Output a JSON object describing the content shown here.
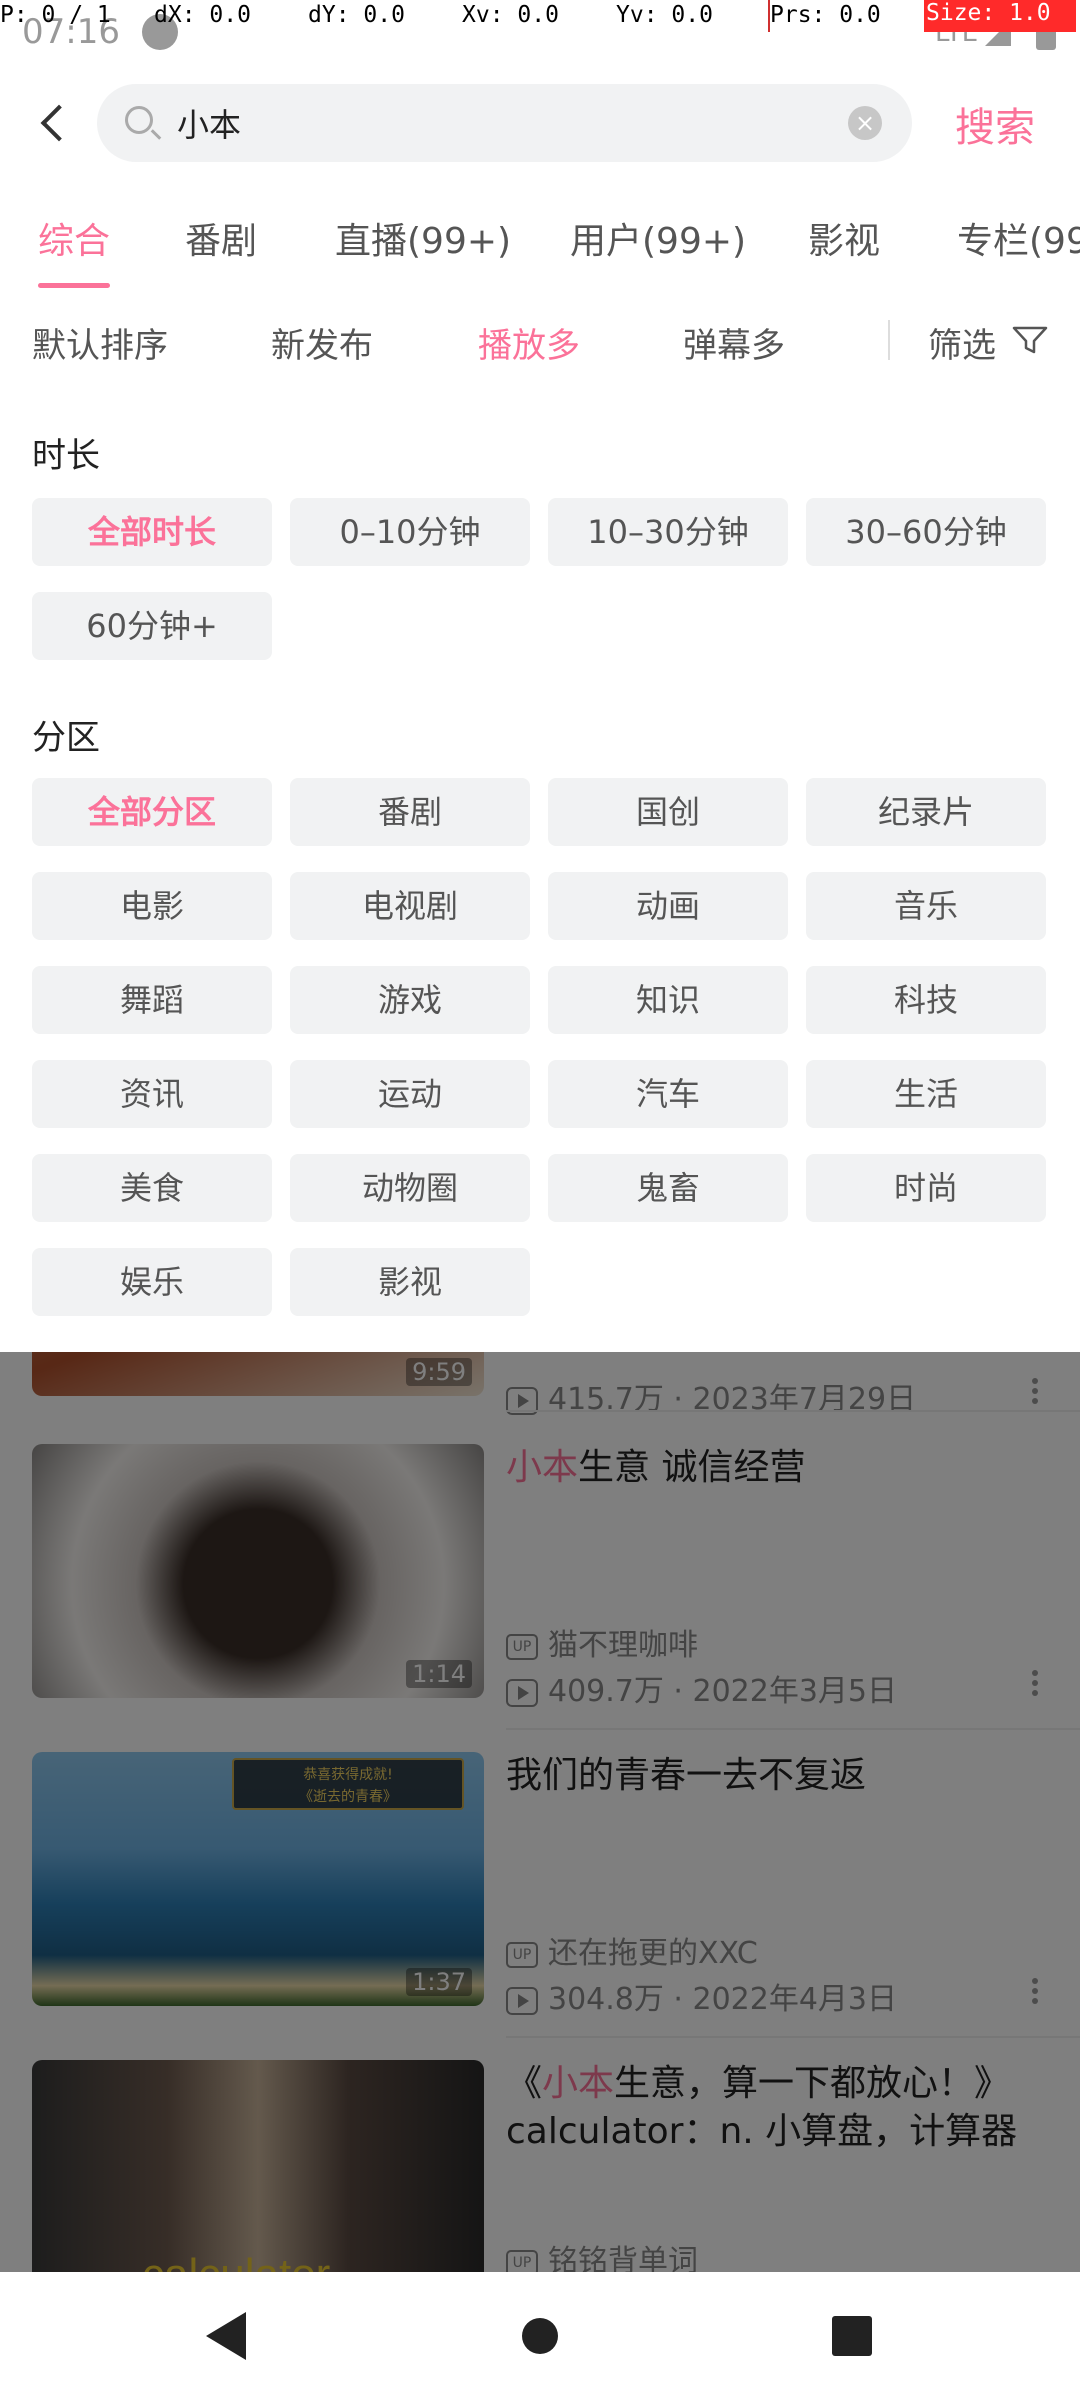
{
  "debug": {
    "pointer": "P: 0 / 1",
    "dx": "dX: 0.0",
    "dy": "dY: 0.0",
    "xv": "Xv: 0.0",
    "yv": "Yv: 0.0",
    "prs": "Prs: 0.0",
    "size": "Size: 1.0"
  },
  "status_bar": {
    "time": "07:16",
    "network": "LTE"
  },
  "search": {
    "query": "小本",
    "submit_label": "搜索"
  },
  "tabs": [
    {
      "label": "综合",
      "active": true
    },
    {
      "label": "番剧",
      "active": false
    },
    {
      "label": "直播(99+)",
      "active": false
    },
    {
      "label": "用户(99+)",
      "active": false
    },
    {
      "label": "影视",
      "active": false
    },
    {
      "label": "专栏(99",
      "active": false
    }
  ],
  "sort": [
    {
      "label": "默认排序",
      "active": false
    },
    {
      "label": "新发布",
      "active": false
    },
    {
      "label": "播放多",
      "active": true
    },
    {
      "label": "弹幕多",
      "active": false
    }
  ],
  "filter_label": "筛选",
  "duration": {
    "title": "时长",
    "options": [
      {
        "label": "全部时长",
        "active": true
      },
      {
        "label": "0–10分钟",
        "active": false
      },
      {
        "label": "10–30分钟",
        "active": false
      },
      {
        "label": "30–60分钟",
        "active": false
      },
      {
        "label": "60分钟+",
        "active": false
      }
    ]
  },
  "partition": {
    "title": "分区",
    "options": [
      {
        "label": "全部分区",
        "active": true
      },
      {
        "label": "番剧",
        "active": false
      },
      {
        "label": "国创",
        "active": false
      },
      {
        "label": "纪录片",
        "active": false
      },
      {
        "label": "电影",
        "active": false
      },
      {
        "label": "电视剧",
        "active": false
      },
      {
        "label": "动画",
        "active": false
      },
      {
        "label": "音乐",
        "active": false
      },
      {
        "label": "舞蹈",
        "active": false
      },
      {
        "label": "游戏",
        "active": false
      },
      {
        "label": "知识",
        "active": false
      },
      {
        "label": "科技",
        "active": false
      },
      {
        "label": "资讯",
        "active": false
      },
      {
        "label": "运动",
        "active": false
      },
      {
        "label": "汽车",
        "active": false
      },
      {
        "label": "生活",
        "active": false
      },
      {
        "label": "美食",
        "active": false
      },
      {
        "label": "动物圈",
        "active": false
      },
      {
        "label": "鬼畜",
        "active": false
      },
      {
        "label": "时尚",
        "active": false
      },
      {
        "label": "娱乐",
        "active": false
      },
      {
        "label": "影视",
        "active": false
      }
    ]
  },
  "results": [
    {
      "title_hl": "",
      "title_rest": "",
      "up": "",
      "stats": "415.7万 · 2023年7月29日",
      "duration": "9:59"
    },
    {
      "title_hl": "小本",
      "title_rest": "生意 诚信经营",
      "up": "猫不理咖啡",
      "stats": "409.7万 · 2022年3月5日",
      "duration": "1:14"
    },
    {
      "title_hl": "",
      "title_rest": "我们的青春一去不复返",
      "up": "还在拖更的XXC",
      "stats": "304.8万 · 2022年4月3日",
      "duration": "1:37"
    },
    {
      "title_pre": "《",
      "title_hl": "小本",
      "title_rest": "生意，算一下都放心！》calculator：n. 小算盘，计算器",
      "up": "铭铭背单词",
      "stats": "",
      "duration": ""
    }
  ],
  "thumb_texts": {
    "achievement_line1": "恭喜获得成就!",
    "achievement_line2": "《逝去的青春》",
    "caption": "calculator"
  }
}
